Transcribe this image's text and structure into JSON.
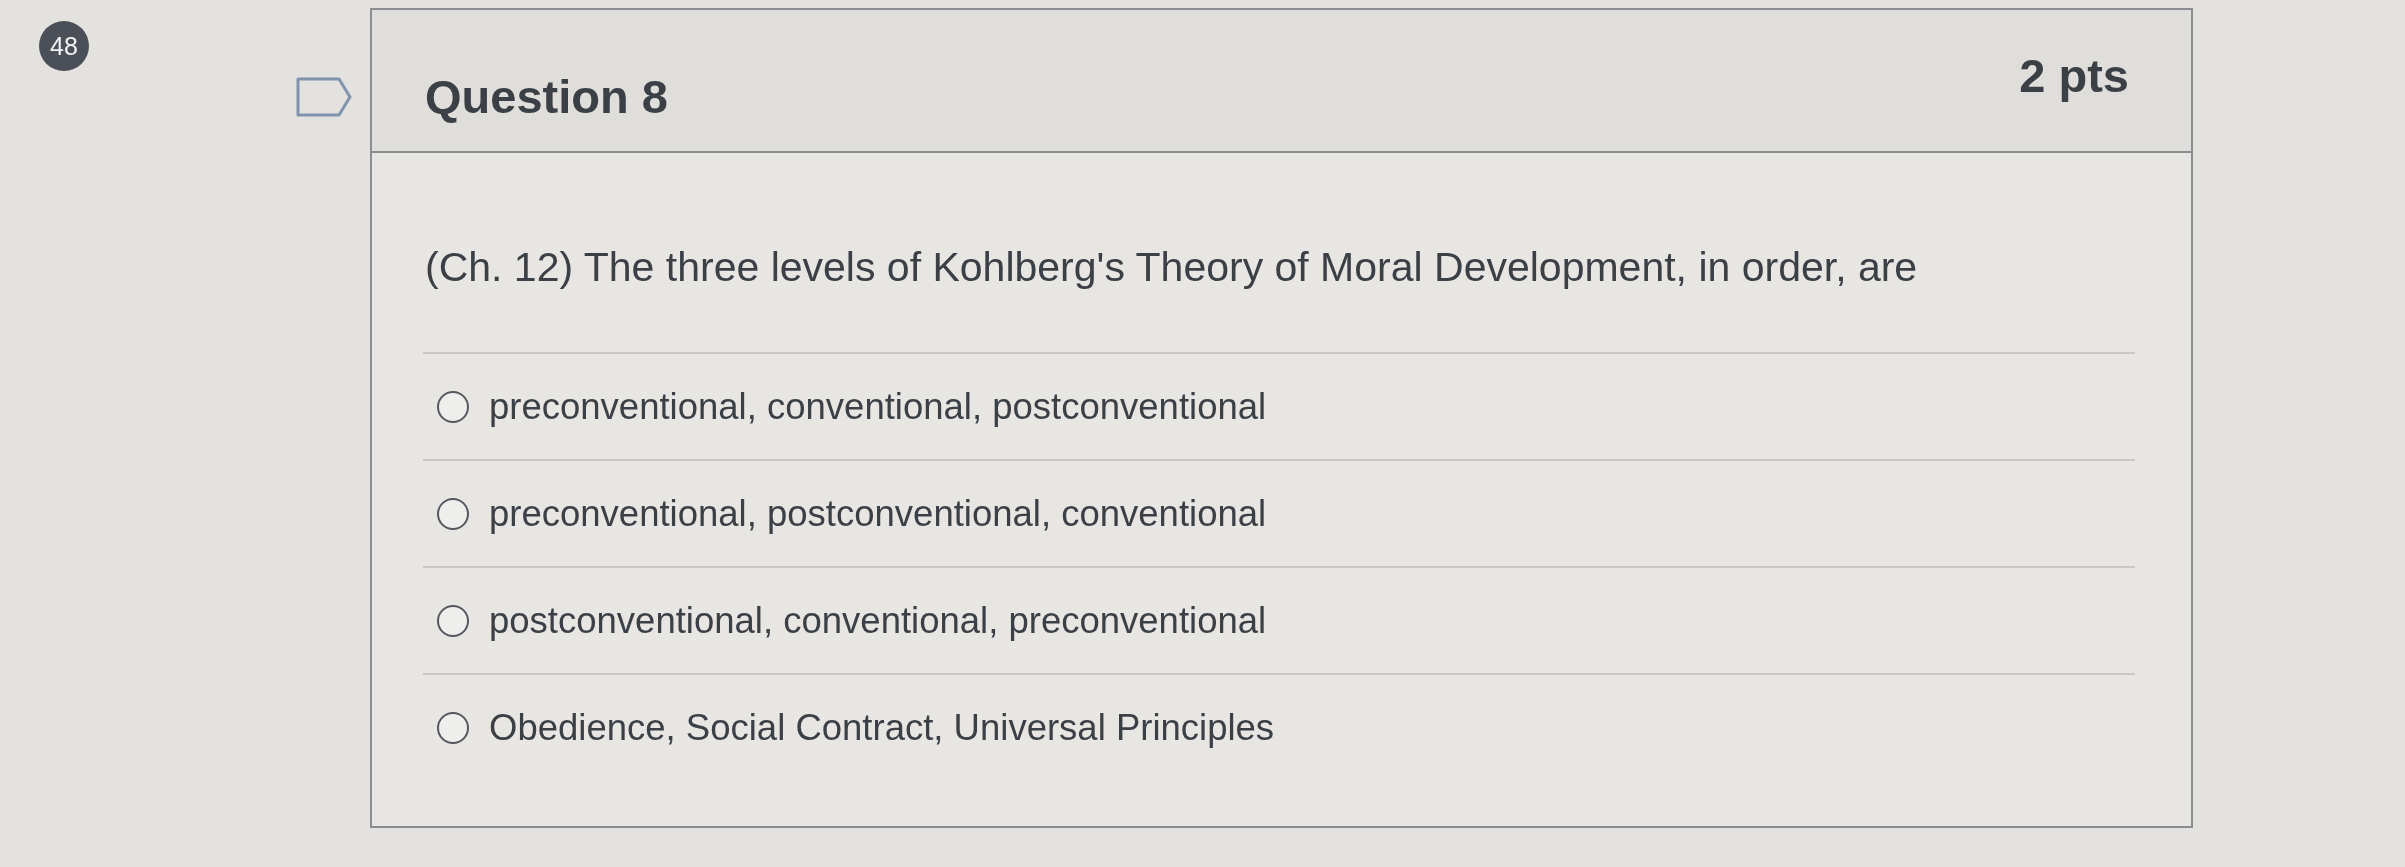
{
  "question_number": "48",
  "question": {
    "flagged": false,
    "title": "Question 8",
    "points": "2 pts",
    "text": "(Ch. 12) The three levels of Kohlberg's Theory of Moral Development, in order, are",
    "answers": [
      {
        "label": "preconventional, conventional, postconventional",
        "selected": false
      },
      {
        "label": "preconventional, postconventional, conventional",
        "selected": false
      },
      {
        "label": "postconventional, conventional, preconventional",
        "selected": false
      },
      {
        "label": "Obedience, Social Contract, Universal Principles",
        "selected": false
      }
    ]
  }
}
